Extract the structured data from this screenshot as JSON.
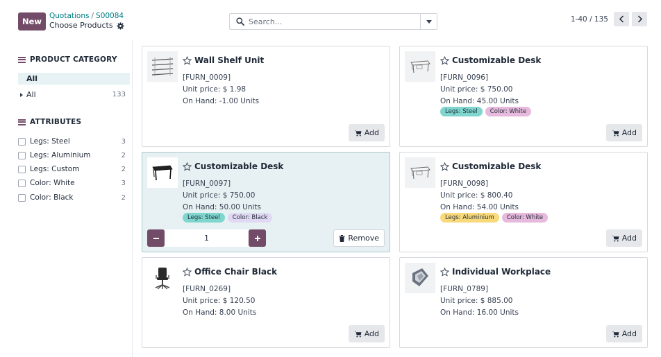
{
  "header": {
    "new_label": "New",
    "breadcrumb_parent": "Quotations",
    "breadcrumb_separator": "/",
    "breadcrumb_record": "S00084",
    "current_view": "Choose Products",
    "accent_color": "#714b67"
  },
  "search": {
    "placeholder": "Search...",
    "value": ""
  },
  "pager": {
    "value": "1-40 / 135"
  },
  "sidebar": {
    "category_heading": "PRODUCT CATEGORY",
    "categories": [
      {
        "label": "All",
        "count": ""
      },
      {
        "label": "All",
        "count": "133"
      }
    ],
    "attributes_heading": "ATTRIBUTES",
    "attributes": [
      {
        "label": "Legs: Steel",
        "count": "3"
      },
      {
        "label": "Legs: Aluminium",
        "count": "2"
      },
      {
        "label": "Legs: Custom",
        "count": "2"
      },
      {
        "label": "Color: White",
        "count": "3"
      },
      {
        "label": "Color: Black",
        "count": "2"
      }
    ]
  },
  "products": [
    {
      "name": "Wall Shelf Unit",
      "ref": "[FURN_0009]",
      "price": "Unit price: $ 1.98",
      "onhand": "On Hand: -1.00 Units",
      "tags": [],
      "action": "Add",
      "icon": "shelf-image"
    },
    {
      "name": "Customizable Desk",
      "ref": "[FURN_0096]",
      "price": "Unit price: $ 750.00",
      "onhand": "On Hand: 45.00 Units",
      "tags": [
        "Legs: Steel",
        "Color: White"
      ],
      "action": "Add",
      "icon": "desk-white-image"
    },
    {
      "name": "Customizable Desk",
      "ref": "[FURN_0097]",
      "price": "Unit price: $ 750.00",
      "onhand": "On Hand: 50.00 Units",
      "tags": [
        "Legs: Steel",
        "Color: Black"
      ],
      "action": "Remove",
      "quantity": "1",
      "icon": "desk-black-image"
    },
    {
      "name": "Customizable Desk",
      "ref": "[FURN_0098]",
      "price": "Unit price: $ 800.40",
      "onhand": "On Hand: 54.00 Units",
      "tags": [
        "Legs: Aluminium",
        "Color: White"
      ],
      "action": "Add",
      "icon": "desk-white-image"
    },
    {
      "name": "Office Chair Black",
      "ref": "[FURN_0269]",
      "price": "Unit price: $ 120.50",
      "onhand": "On Hand: 8.00 Units",
      "tags": [],
      "action": "Add",
      "icon": "office-chair-image"
    },
    {
      "name": "Individual Workplace",
      "ref": "[FURN_0789]",
      "price": "Unit price: $ 885.00",
      "onhand": "On Hand: 16.00 Units",
      "tags": [],
      "action": "Add",
      "icon": "workplace-image"
    }
  ],
  "tag_colors": {
    "Legs: Steel": "#7fd6cf",
    "Color: White": "#e7b9dc",
    "Color: Black": "#e1d8f3",
    "Legs: Aluminium": "#f8d97c"
  },
  "selection_color": "#e7f1f3"
}
